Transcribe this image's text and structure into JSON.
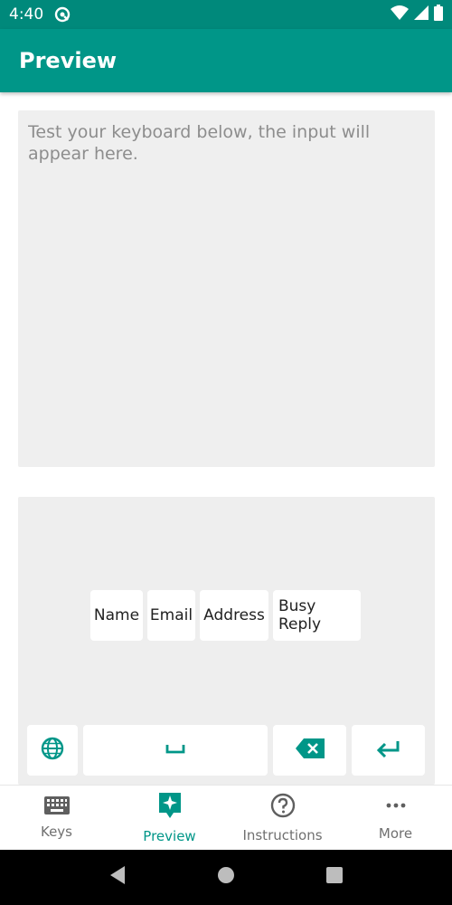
{
  "status_bar": {
    "time": "4:40"
  },
  "app_bar": {
    "title": "Preview"
  },
  "preview": {
    "placeholder": "Test your keyboard below, the input will appear here.",
    "value": ""
  },
  "keyboard": {
    "chips": [
      "Name",
      "Email",
      "Address",
      "Busy Reply"
    ],
    "keys": [
      "globe-icon",
      "space-icon",
      "backspace-icon",
      "enter-icon"
    ]
  },
  "bottom_nav": {
    "items": [
      {
        "label": "Keys",
        "icon": "keyboard-icon"
      },
      {
        "label": "Preview",
        "icon": "sparkle-icon"
      },
      {
        "label": "Instructions",
        "icon": "help-icon"
      },
      {
        "label": "More",
        "icon": "more-horiz-icon"
      }
    ],
    "active": "Preview"
  },
  "colors": {
    "primary": "#009688",
    "status_bar": "#00897b",
    "surface": "#efefef"
  }
}
